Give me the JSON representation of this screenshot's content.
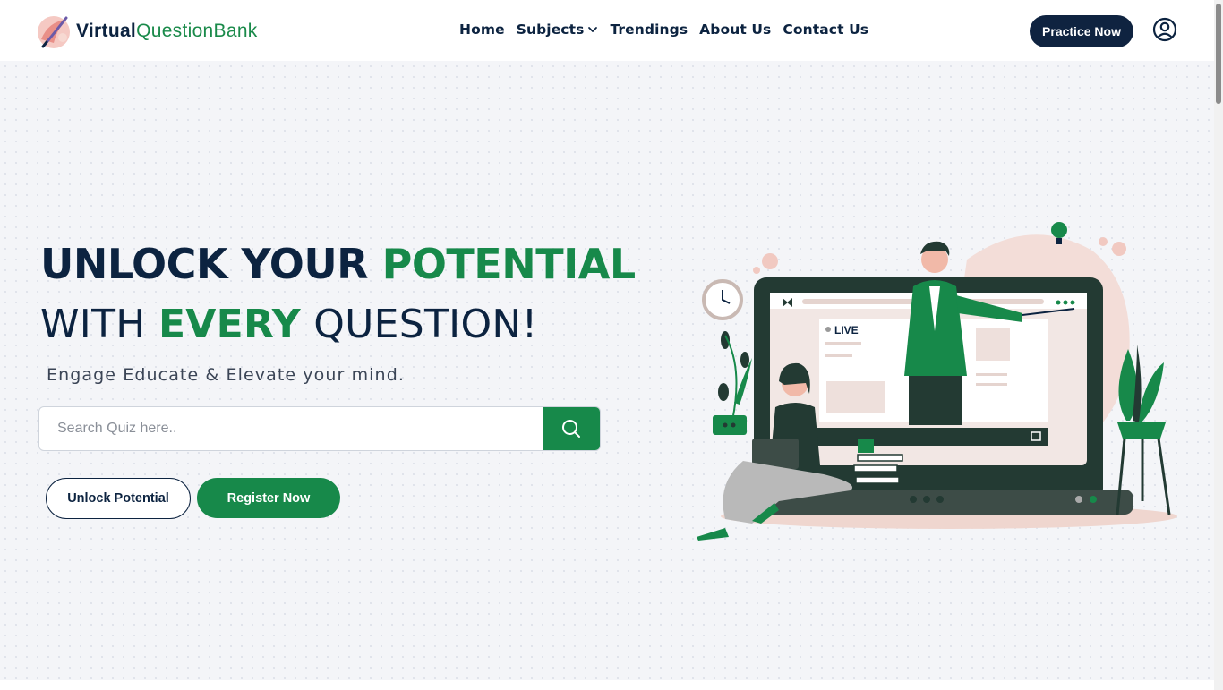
{
  "brand": {
    "name_part1": "Virtual",
    "name_part2": "QuestionBank"
  },
  "nav": {
    "items": [
      {
        "label": "Home"
      },
      {
        "label": "Subjects",
        "has_dropdown": true
      },
      {
        "label": "Trendings"
      },
      {
        "label": "About Us"
      },
      {
        "label": "Contact Us"
      }
    ],
    "practice_label": "Practice Now"
  },
  "hero": {
    "headline1_a": "UNLOCK YOUR ",
    "headline1_b": "POTENTIAL",
    "headline2_a": "WITH ",
    "headline2_b": "EVERY",
    "headline2_c": " QUESTION!",
    "tagline": "Engage Educate & Elevate your mind.",
    "search_placeholder": "Search Quiz here..",
    "unlock_label": "Unlock Potential",
    "register_label": "Register Now"
  },
  "illustration": {
    "live_label": "LIVE"
  },
  "colors": {
    "navy": "#0c2340",
    "green": "#17894a",
    "background": "#f4f5f8"
  },
  "icons": [
    "logo-icon",
    "chevron-down-icon",
    "user-circle-icon",
    "search-icon"
  ]
}
